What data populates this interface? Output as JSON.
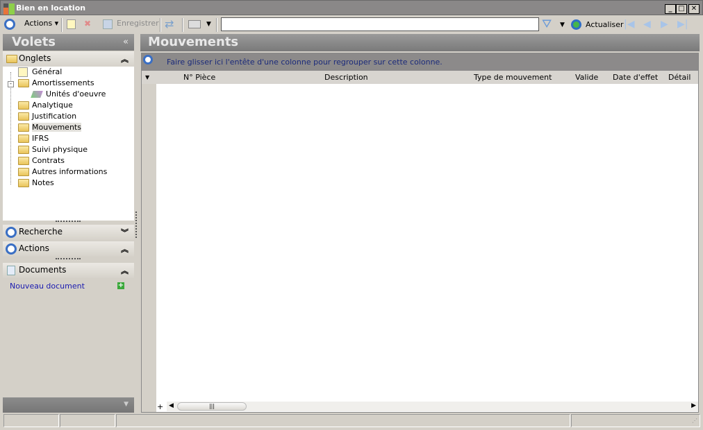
{
  "window": {
    "title": "Bien en location"
  },
  "toolbar": {
    "actions": "Actions",
    "save": "Enregistrer",
    "refresh": "Actualiser",
    "search_value": ""
  },
  "left_pane": {
    "title": "Volets",
    "onglets": {
      "title": "Onglets",
      "items": [
        {
          "label": "Général",
          "level": 0
        },
        {
          "label": "Amortissements",
          "level": 0
        },
        {
          "label": "Unités d'oeuvre",
          "level": 1
        },
        {
          "label": "Analytique",
          "level": 0
        },
        {
          "label": "Justification",
          "level": 0
        },
        {
          "label": "Mouvements",
          "level": 0,
          "selected": true
        },
        {
          "label": "IFRS",
          "level": 0
        },
        {
          "label": "Suivi physique",
          "level": 0
        },
        {
          "label": "Contrats",
          "level": 0
        },
        {
          "label": "Autres informations",
          "level": 0
        },
        {
          "label": "Notes",
          "level": 0
        }
      ]
    },
    "recherche": "Recherche",
    "actions": "Actions",
    "documents": "Documents",
    "new_document": "Nouveau document"
  },
  "main": {
    "title": "Mouvements",
    "group_hint": "Faire glisser ici l'entête d'une colonne pour regrouper sur cette colonne.",
    "columns": [
      "N° Pièce",
      "Description",
      "Type de mouvement",
      "Valide",
      "Date d'effet",
      "Détail"
    ]
  }
}
